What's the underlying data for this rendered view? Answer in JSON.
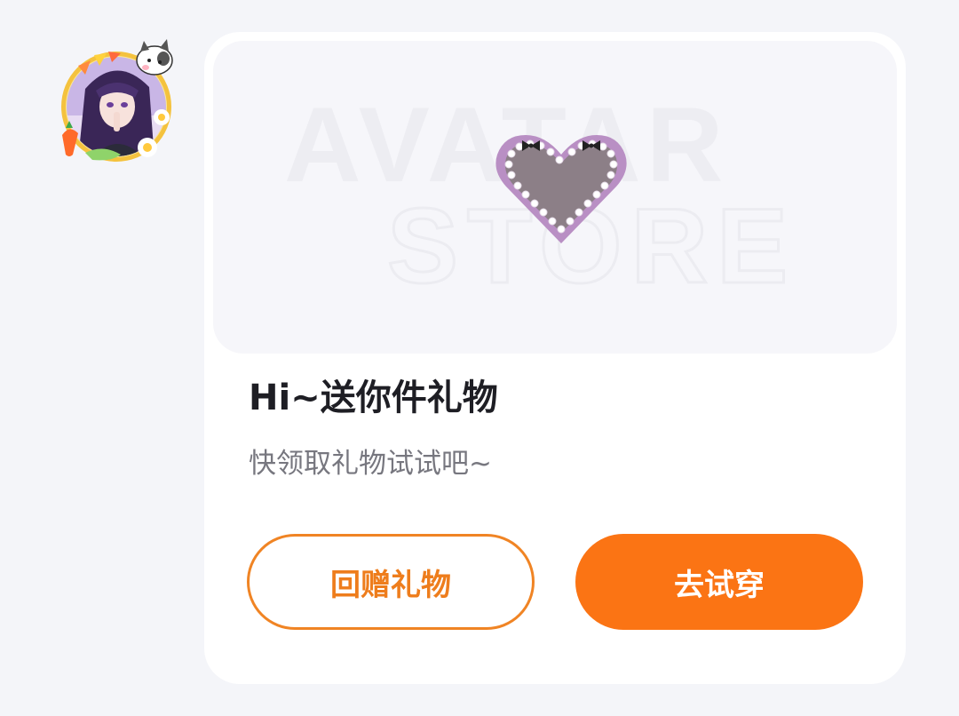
{
  "chat": {
    "sender_avatar": {
      "description": "anime avatar"
    }
  },
  "gift_card": {
    "banner": {
      "watermark_line1": "AVATAR",
      "watermark_line2": "STORE",
      "item_icon": "heart-frame-icon"
    },
    "title": "Hi~送你件礼物",
    "subtitle": "快领取礼物试试吧~",
    "buttons": {
      "return_gift": "回赠礼物",
      "try_on": "去试穿"
    },
    "colors": {
      "accent": "#fb7414",
      "outline": "#f08424",
      "card_bg": "#ffffff",
      "page_bg": "#f4f5f9"
    }
  }
}
